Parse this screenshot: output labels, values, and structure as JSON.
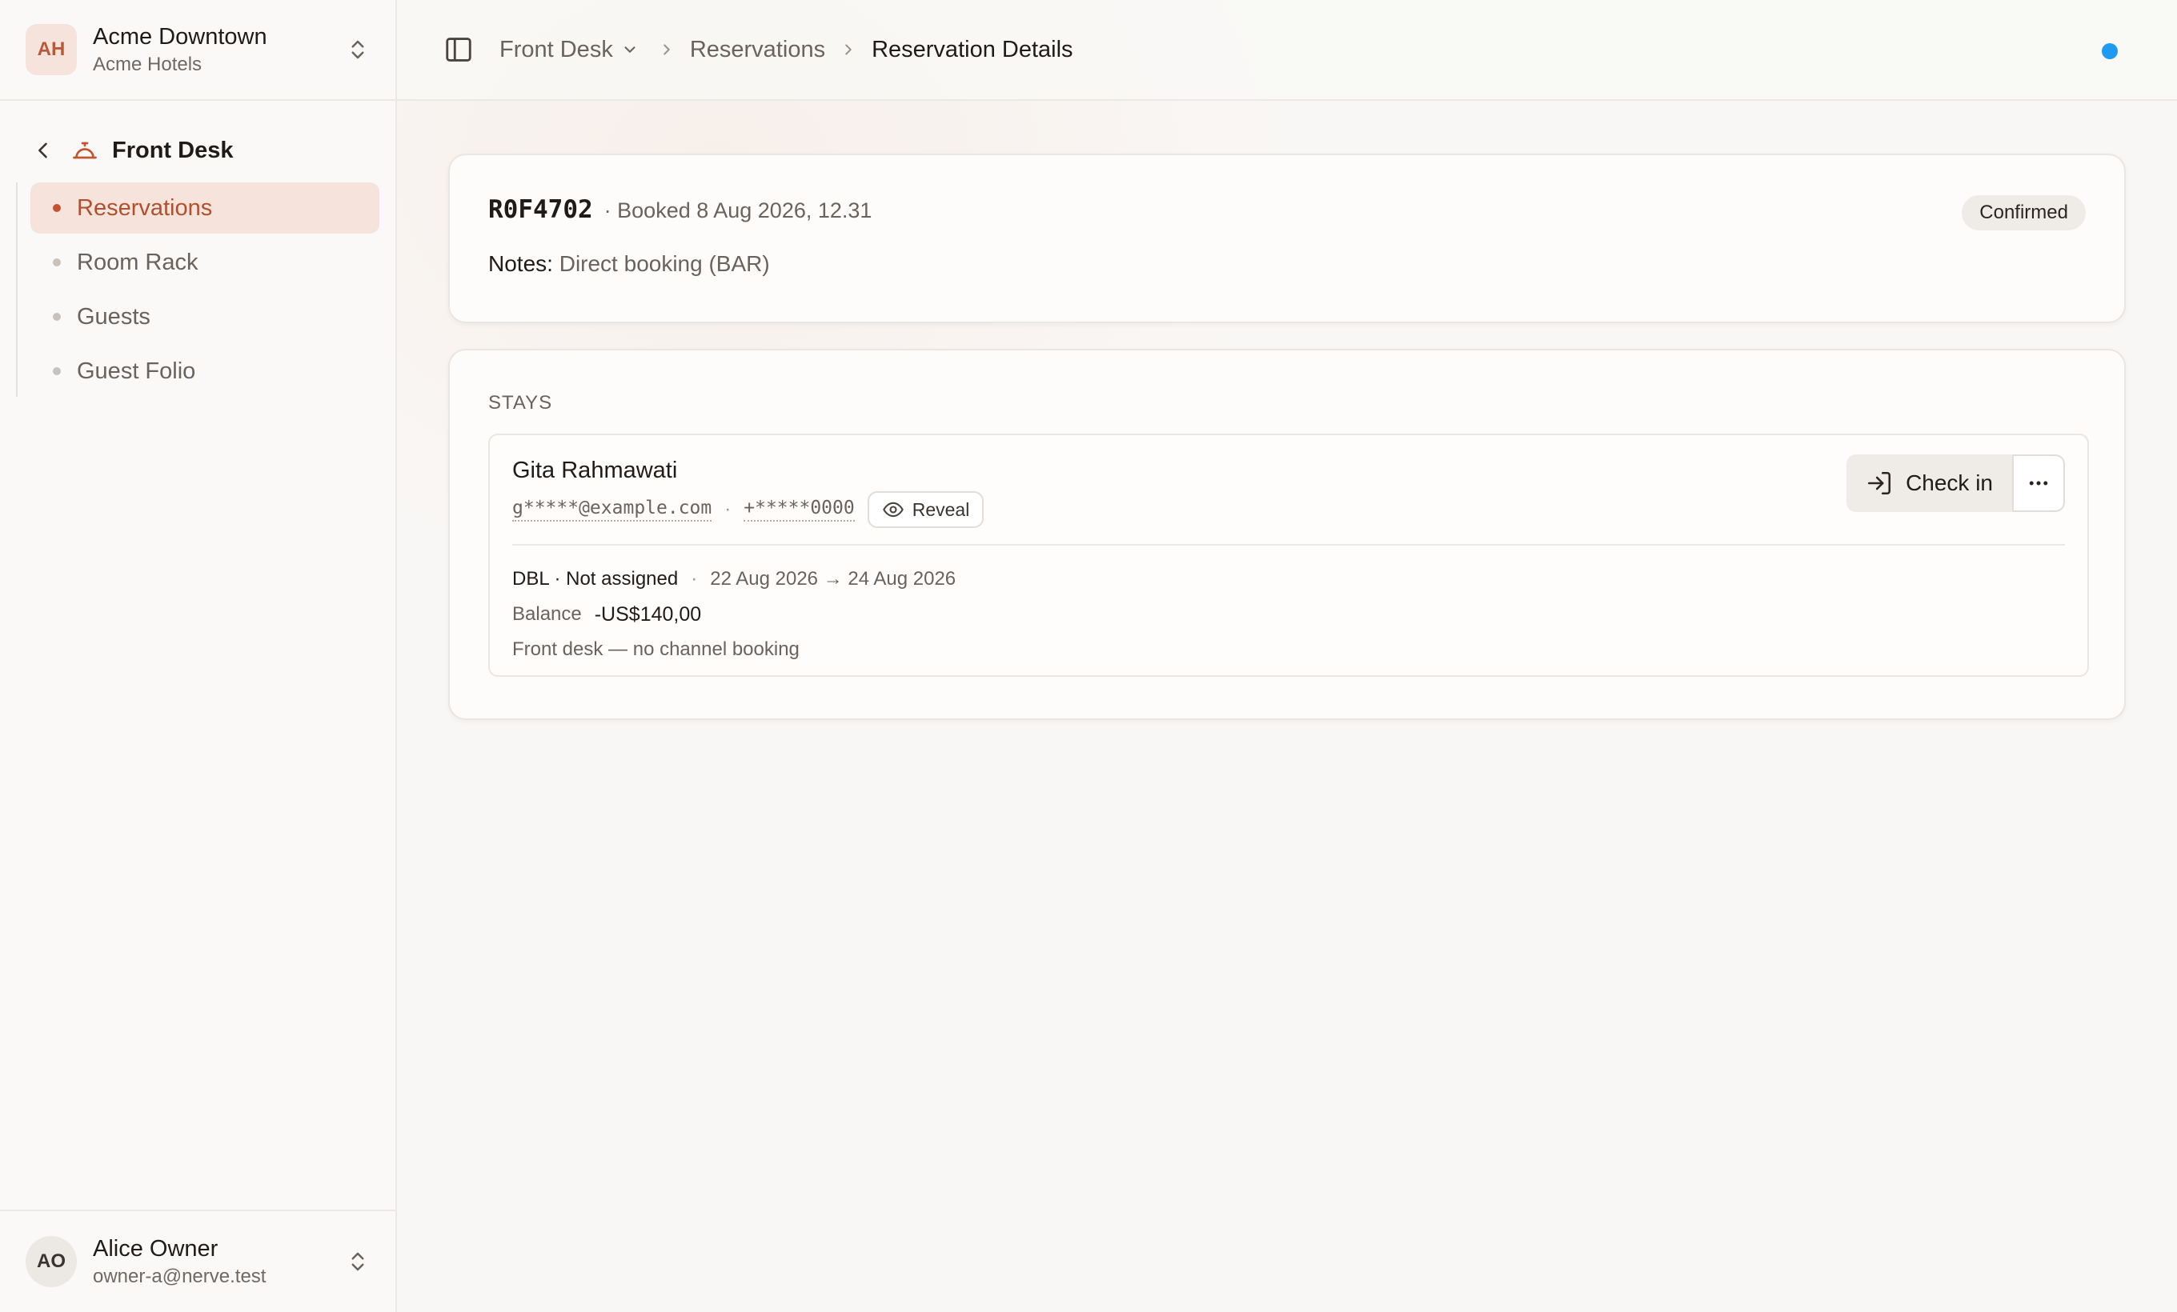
{
  "org": {
    "initials": "AH",
    "name": "Acme Downtown",
    "company": "Acme Hotels"
  },
  "nav": {
    "section": "Front Desk",
    "items": [
      {
        "label": "Reservations",
        "active": true
      },
      {
        "label": "Room Rack",
        "active": false
      },
      {
        "label": "Guests",
        "active": false
      },
      {
        "label": "Guest Folio",
        "active": false
      }
    ]
  },
  "user": {
    "initials": "AO",
    "name": "Alice Owner",
    "email": "owner-a@nerve.test"
  },
  "breadcrumb": {
    "first": "Front Desk",
    "second": "Reservations",
    "current": "Reservation Details"
  },
  "status_dot_color": "#1e9bf0",
  "reservation": {
    "code": "R0F4702",
    "booked": "· Booked 8 Aug 2026, 12.31",
    "status": "Confirmed",
    "notes_label": "Notes:",
    "notes_value": "Direct booking (BAR)"
  },
  "stays": {
    "title": "STAYS",
    "items": [
      {
        "guest": "Gita Rahmawati",
        "email_masked": "g*****@example.com",
        "separator": "·",
        "phone_masked": "+*****0000",
        "reveal_label": "Reveal",
        "checkin_label": "Check in",
        "room_type": "DBL · Not assigned",
        "dates": "22 Aug 2026 → 24 Aug 2026",
        "balance_label": "Balance",
        "balance_value": "-US$140,00",
        "channel": "Front desk — no channel booking"
      }
    ]
  },
  "colors": {
    "accent": "#c2542f",
    "accent_bg": "#f6e4dc",
    "badge_bg": "#efebe7"
  }
}
